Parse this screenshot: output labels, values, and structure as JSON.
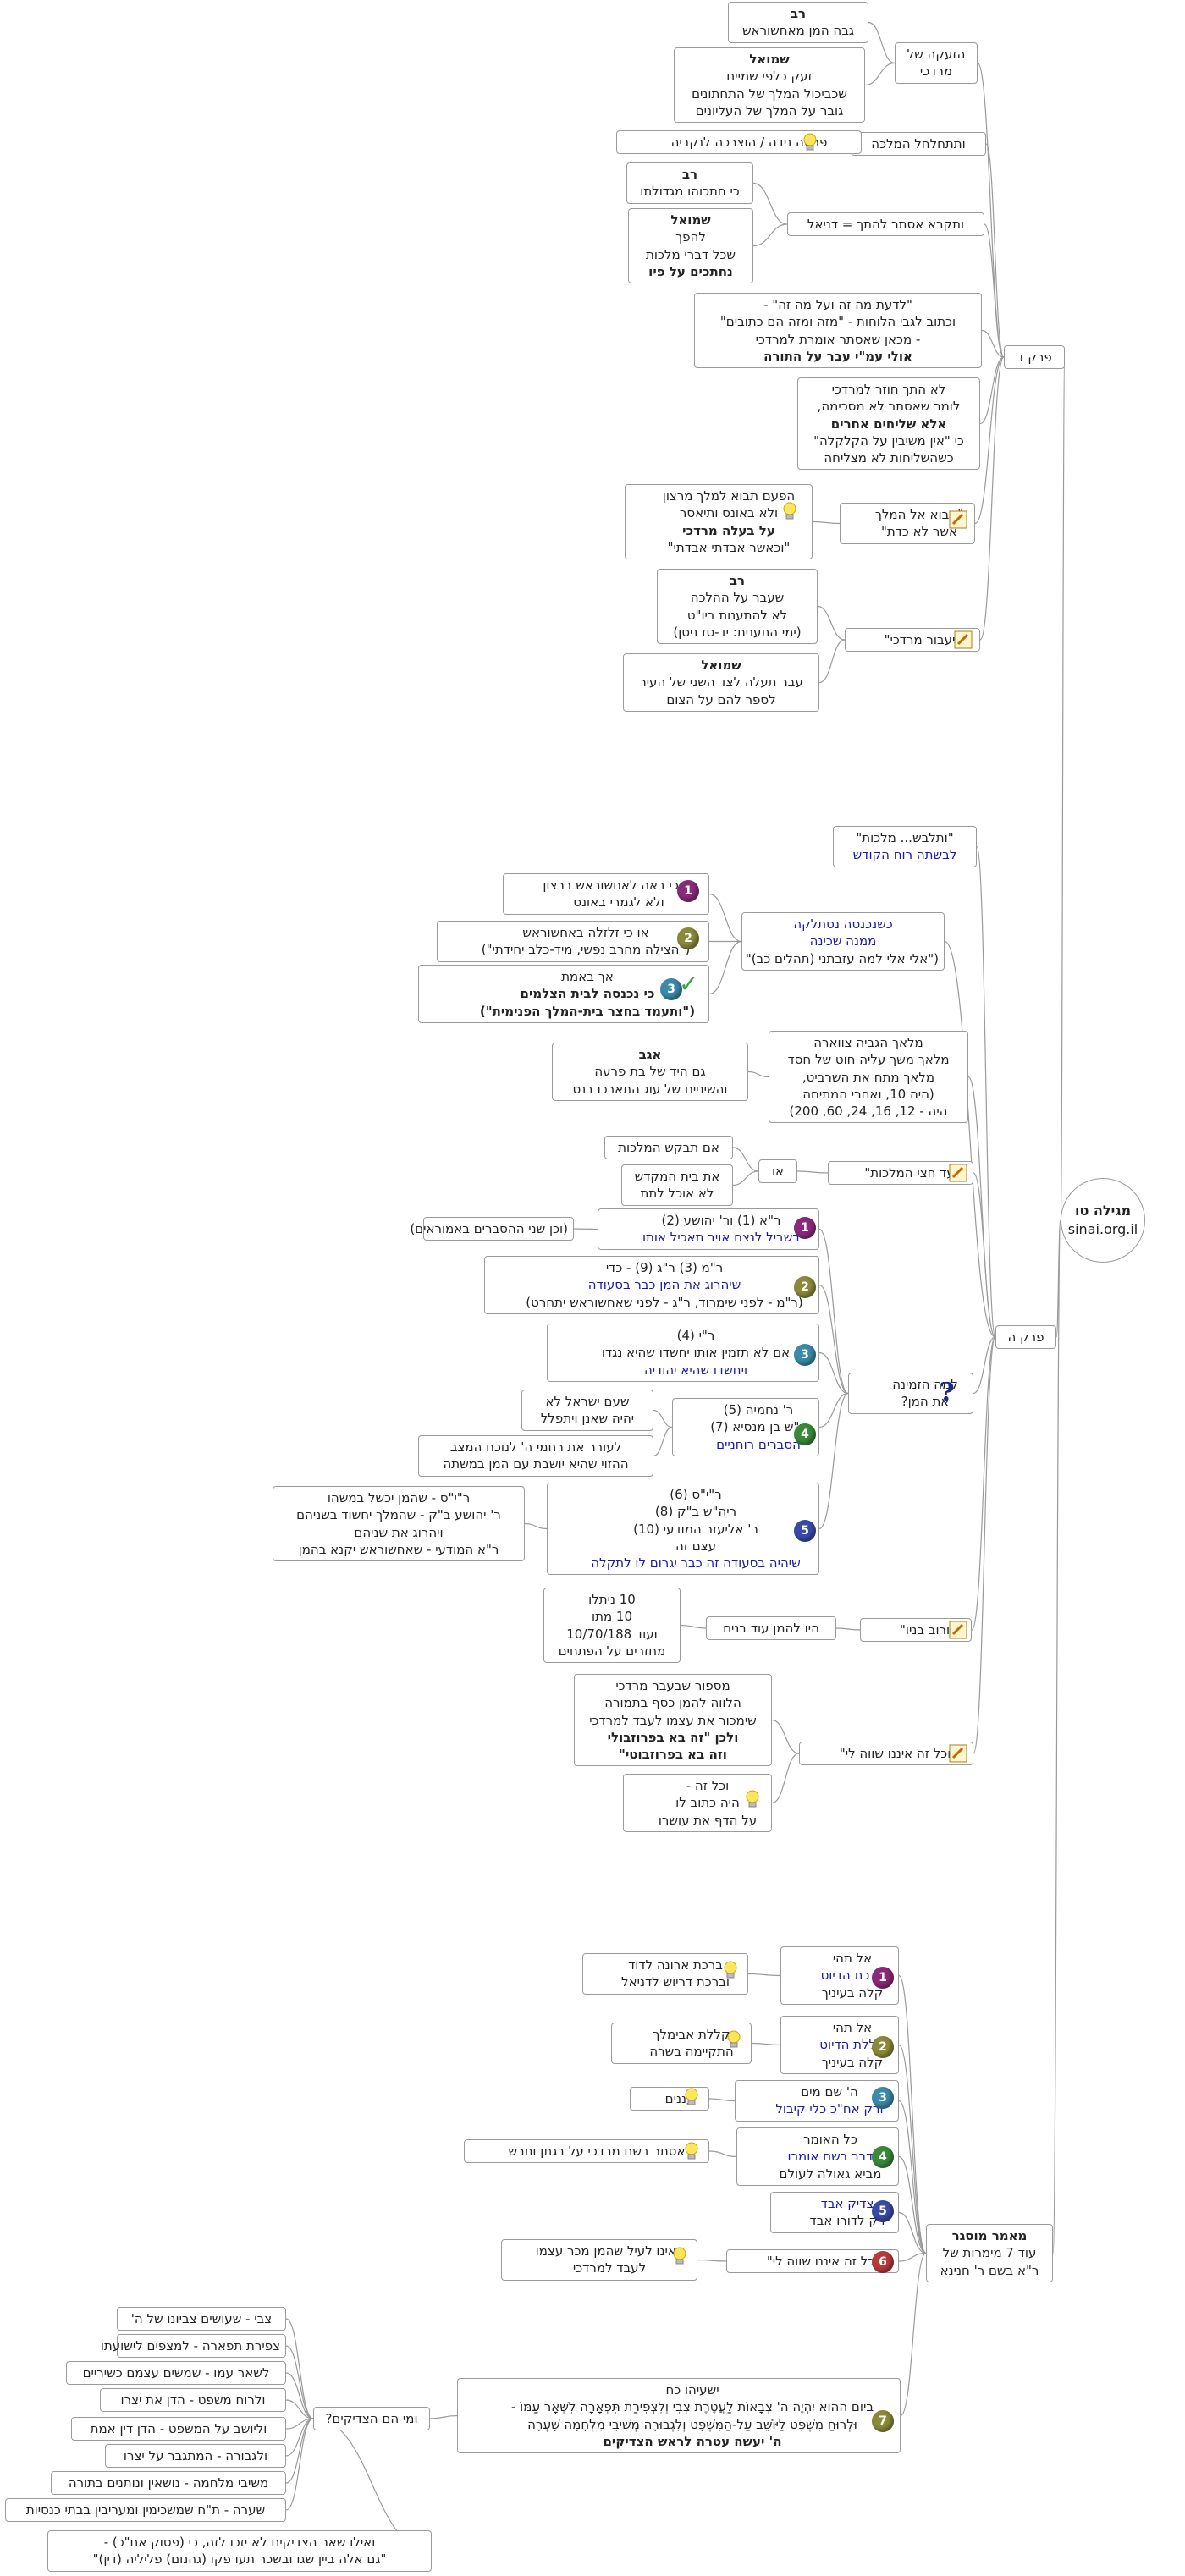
{
  "colors": {
    "line": "#9a9a9a",
    "blue_text": "#1a1aa8",
    "border": "#9a9a9a"
  },
  "root": {
    "title": "מגילה טו",
    "site": "sinai.org.il"
  },
  "perek_d": {
    "label": "פרק ד",
    "zeaka": {
      "label": [
        "הזעקה של",
        "מרדכי"
      ],
      "rav": [
        "רב",
        "גבה המן מאחשוראש"
      ],
      "shmuel": [
        "שמואל",
        "זעק כלפי שמיים",
        "שכביכול המלך של התחתונים",
        "גובר על המלך של העליונים"
      ]
    },
    "malka": {
      "label": "ותתחלחל המלכה",
      "note": "פרסה נידה / הוצרכה לנקביה"
    },
    "vatikra": {
      "label": "ותקרא אסתר להתך = דניאל",
      "rav": [
        "רב",
        "כי חתכוהו מגדולתו"
      ],
      "shmuel": [
        "שמואל",
        "להפך",
        "שכל דברי מלכות",
        "נחתכים על פיו"
      ]
    },
    "ladaat": [
      "\"לדעת מה זה ועל מה זה\" -",
      "וכתוב לגבי הלוחות - \"מזה ומזה הם כתובים\"",
      "- מכאן שאסתר אומרת למרדכי",
      "אולי עמ\"י עבר על התורה"
    ],
    "shluchim": [
      "לא התך חוזר למרדכי",
      "לומר שאסתר לא מסכימה,",
      "אלא שליחים אחרים",
      "כי \"אין משיבין על הקלקלה\"",
      "כשהשליחות לא מצליחה"
    ],
    "avo": {
      "label": [
        "\"אבוא אל המלך",
        "אשר לא כדת\""
      ],
      "note": [
        "הפעם תבוא למלך מרצון",
        "ולא באונס ותיאסר",
        "על בעלה מרדכי",
        "\"וכאשר אבדתי אבדתי\""
      ]
    },
    "vayaavor": {
      "label": "\"ויעבור מרדכי\"",
      "rav": [
        "רב",
        "שעבר על ההלכה",
        "לא להתענות ביו\"ט",
        "(ימי התענית: יד-טז ניסן)"
      ],
      "shmuel": [
        "שמואל",
        "עבר תעלה לצד השני של העיר",
        "לספר להם על הצום"
      ]
    }
  },
  "perek_h": {
    "label": "פרק ה",
    "vatilbash": [
      "\"ותלבש... מלכות\"",
      "לבשתה רוח הקודש"
    ],
    "shekinah": {
      "label": [
        "כשנכנסה נסתלקה",
        "ממנה שכינה",
        "(\"אלי אלי למה עזבתני (תהלים כב)\""
      ],
      "items": [
        [
          "או כי באה לאחשוראש ברצון",
          "ולא לגמרי באונס"
        ],
        [
          "או כי זלזלה  באחשוראש",
          "(\"הצילה מחרב נפשי, מיד-כלב  יחידתי\")"
        ],
        [
          "אך באמת",
          "כי נכנסה לבית הצלמים",
          "(\"ותעמד  בחצר בית-המלך הפנימית\")"
        ]
      ]
    },
    "malachim": {
      "label": [
        "מלאך הגביה צווארה",
        "מלאך משך עליה חוט של חסד",
        "מלאך מתח את השרביט,",
        "(היה 10, ואחרי המתיחה",
        "היה - 12, 16, 24, 60, 200)"
      ],
      "agav": [
        "אגב",
        "גם היד של בת פרעה",
        "והשיניים של עוג התארכו בנס"
      ]
    },
    "ad_chatzi": {
      "label": "\"עד חצי המלכות\"",
      "or": "או",
      "a": "אם תבקש המלכות",
      "b": [
        "את בית המקדש",
        "לא אוכל לתת"
      ]
    },
    "lama": {
      "label": [
        "למה הזמינה",
        "את המן?"
      ],
      "items": [
        {
          "text": [
            "ר\"א (1) ור' יהושע (2)",
            "בשביל לנצח אויב תאכיל אותו"
          ],
          "note": [
            "(וכן שני ההסברים באמוראים)"
          ]
        },
        {
          "text": [
            "ר\"מ (3) ר\"ג (9) - כדי",
            "שיהרוג את המן כבר בסעודה",
            "(ר\"מ - לפני שימרוד, ר\"ג - לפני שאחשוראש יתחרט)"
          ]
        },
        {
          "text": [
            "ר\"י (4)",
            "אם לא תזמין אותו יחשדו שהיא נגדו",
            "ויחשדו שהיא יהודיה"
          ]
        },
        {
          "text": [
            "ר' נחמיה (5)",
            "ר\"ש בן מנסיא (7)",
            "הסברים רוחניים"
          ],
          "notes": [
            [
              "שעם ישראל לא",
              "יהיה שאנן ויתפלל"
            ],
            [
              "לעורר את רחמי ה' לנוכח המצב",
              "ההזוי שהיא יושבת עם המן במשתה"
            ]
          ]
        },
        {
          "text": [
            "ר\"י\"ס (6)",
            "ריה\"ש ב\"ק (8)",
            "ר' אליעזר המודעי (10)",
            "עצם זה",
            "שיהיה בסעודה זה כבר יגרום לו לתקלה"
          ],
          "note": [
            "ר\"י\"ס - שהמן יכשל  במשהו",
            "ר' יהושע ב\"ק - שהמלך יחשוד  בשניהם",
            "ויהרוג את שניהם",
            "ר\"א המודעי - שאחשוראש יקנא  בהמן"
          ]
        }
      ]
    },
    "rov_banav": {
      "label": "\"ורוב בניו\"",
      "mid": "היו להמן עוד בנים",
      "right": [
        "10 ניתלו",
        "10 מתו",
        "ועוד 10/70/188",
        "מחזרים על הפתחים"
      ]
    },
    "vechol_ze": {
      "label": "\"וכל זה איננו שווה לי\"",
      "a": [
        "מספור שבעבר מרדכי",
        "הלווה להמן כסף בתמורה",
        "שימכור את עצמו לעבד למרדכי",
        "ולכן \"זה בא בפרוזבולי",
        "וזה בא בפרוזבוטי\""
      ],
      "b": [
        "וכל זה -",
        "היה כתוב לו",
        "על הדף את עושרו"
      ]
    }
  },
  "maamar": {
    "label": [
      "מאמר מוסגר",
      "עוד 7 מימרות של",
      "ר\"א בשם ר' חנינא"
    ],
    "items": [
      {
        "n": "1",
        "color": "#8a2a7a",
        "text": [
          "אל תהי",
          "ברכת הדיוט",
          "קלה בעיניך"
        ],
        "note": [
          "ברכת ארונה לדוד",
          "וברכת דריוש לדניאל"
        ]
      },
      {
        "n": "2",
        "color": "#8a8a3a",
        "text": [
          "אל תהי",
          "קללת הדיוט",
          "קלה בעיניך"
        ],
        "note": [
          "קללת אבימלך",
          "התקיימה בשרה"
        ]
      },
      {
        "n": "3",
        "color": "#3a8aa8",
        "text": [
          "ה' שם מים",
          "ורק אח\"כ כלי קיבול"
        ],
        "note": [
          "עננים"
        ]
      },
      {
        "n": "4",
        "color": "#3a8a3a",
        "text": [
          "כל האומר",
          "דבר בשם אומרו",
          "מביא גאולה לעולם"
        ],
        "note": [
          "אסתר בשם מרדכי על בגתן ותרש"
        ]
      },
      {
        "n": "5",
        "color": "#3a4aa8",
        "text": [
          "צדיק אבד",
          "רק לדורו אבד"
        ],
        "note": []
      },
      {
        "n": "6",
        "color": "#b83a3a",
        "text": [
          "\"וכל זה איננו שווה לי\""
        ],
        "note": [
          "ראינו לעיל שהמן מכר עצמו",
          "לעבד למרדכי"
        ]
      },
      {
        "n": "7",
        "color": "#8a8a3a",
        "text": [
          "ישעיהו כח",
          "ביום ההוא יִהְיֶה ה' צְבָאוֹת לַעֲטֶרֶת  צְבִי וְלִצְפִירַת תִּפְאָרָה לִשְׁאָר עַמּוֹ -",
          "וּלְרוּחַ מִשְׁפָּט לַיּוֹשֵׁב עַל-הַמִּשְׁפָּט וְלִגְבוּרָה מְשִׁיבֵי מִלְחָמָה שָׁעְרָה",
          "ה' יעשה עטרה לראש הצדיקים"
        ],
        "note": []
      }
    ],
    "tzadikim": {
      "label": "ומי הם הצדיקים?",
      "list": [
        "צבי - שעושים צביונו של ה'",
        "צפירת תפארה - למצפים לישועתו",
        "לשאר עמו - שמשים עצמם כשיריים",
        "ולרוח משפט - הדן את יצרו",
        "וליושב על המשפט - הדן דין אמת",
        "ולגבורה - המתגבר על יצרו",
        "משיבי מלחמה - נושאין ונותנים בתורה",
        "שערה - ת\"ח שמשכימין ומעריבין בבתי כנסיות"
      ],
      "last": [
        "ואילו שאר הצדיקים לא יזכו לזה, כי (פסוק אח\"כ) -",
        "\"גם אלה ביין שגו ובשכר תעו פקו (גהנום) פליליה (דין)\""
      ]
    }
  }
}
